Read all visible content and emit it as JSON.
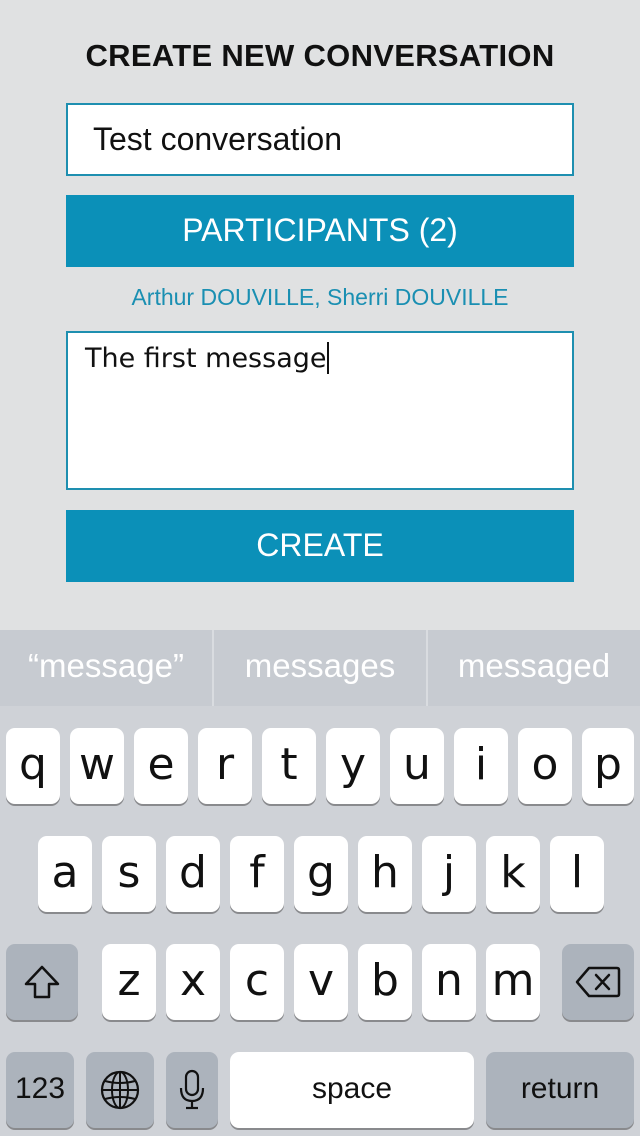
{
  "page": {
    "title": "CREATE NEW CONVERSATION",
    "title_input_value": "Test conversation",
    "participants_button": "PARTICIPANTS (2)",
    "participants_names": "Arthur DOUVILLE, Sherri DOUVILLE",
    "message_value": "The first message",
    "create_button": "CREATE"
  },
  "keyboard": {
    "suggestions": [
      "“message”",
      "messages",
      "messaged"
    ],
    "row1": [
      "q",
      "w",
      "e",
      "r",
      "t",
      "y",
      "u",
      "i",
      "o",
      "p"
    ],
    "row2": [
      "a",
      "s",
      "d",
      "f",
      "g",
      "h",
      "j",
      "k",
      "l"
    ],
    "row3": [
      "z",
      "x",
      "c",
      "v",
      "b",
      "n",
      "m"
    ],
    "numbers_key": "123",
    "space_key": "space",
    "return_key": "return",
    "icons": {
      "shift": "shift-icon",
      "delete": "backspace-icon",
      "globe": "globe-icon",
      "mic": "microphone-icon"
    }
  },
  "colors": {
    "accent": "#0b90b8",
    "background": "#e0e1e2",
    "link": "#1a8fb2"
  }
}
